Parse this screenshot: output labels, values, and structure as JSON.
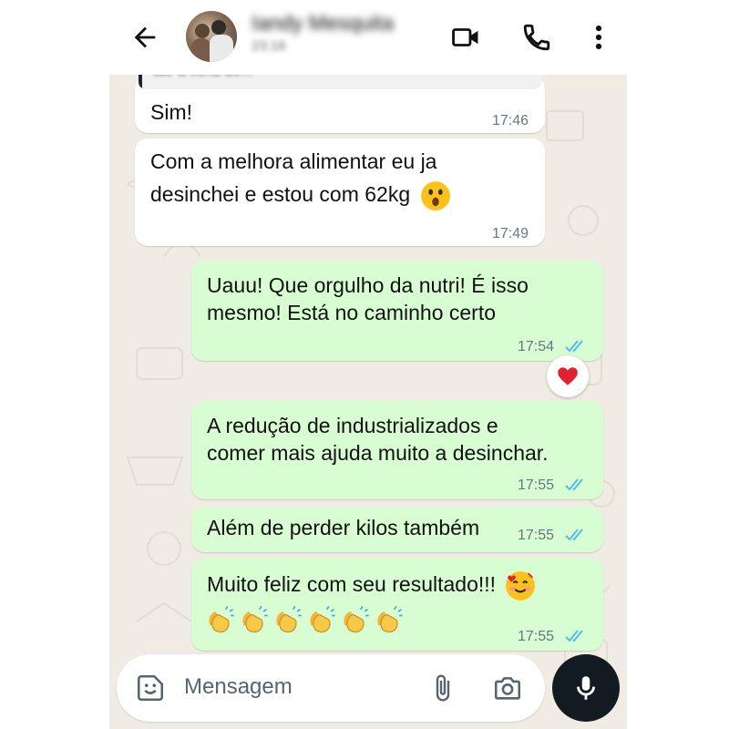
{
  "header": {
    "contact_name": "Iandy Mesquita",
    "contact_status": "23:16",
    "icons": [
      "back-arrow-icon",
      "avatar",
      "video-call-icon",
      "phone-icon",
      "more-vert-icon"
    ]
  },
  "quoted_reply": {
    "text": "até a ficha de..."
  },
  "messages": [
    {
      "direction": "in",
      "text": "Sim!",
      "time": "17:46"
    },
    {
      "direction": "in",
      "lines": [
        "Com a melhora alimentar eu ja",
        "desinchei e estou com 62kg"
      ],
      "emoji": "astonished-face",
      "time": "17:49"
    },
    {
      "direction": "out",
      "lines": [
        "Uauu! Que orgulho da nutri! É isso",
        "mesmo! Está no caminho certo"
      ],
      "time": "17:54",
      "read": true,
      "reaction": "red-heart"
    },
    {
      "direction": "out",
      "lines": [
        "A redução de industrializados e",
        "comer mais ajuda muito a desinchar."
      ],
      "time": "17:55",
      "read": true
    },
    {
      "direction": "out",
      "text": "Além de perder kilos também",
      "time": "17:55",
      "read": true
    },
    {
      "direction": "out",
      "text": "Muito feliz com seu resultado!!!",
      "emoji": "smiling-face-with-hearts",
      "emoji_row": [
        "clapping-hands",
        "clapping-hands",
        "clapping-hands",
        "clapping-hands",
        "clapping-hands",
        "clapping-hands"
      ],
      "time": "17:55",
      "read": true
    }
  ],
  "composer": {
    "placeholder": "Mensagem",
    "icons": [
      "sticker-icon",
      "attach-icon",
      "camera-icon",
      "mic-icon"
    ]
  },
  "colors": {
    "incoming_bubble": "#ffffff",
    "outgoing_bubble": "#d8fdd2",
    "chat_background": "#f1ece3",
    "read_ticks": "#53bdeb",
    "mic_button": "#111b21"
  }
}
